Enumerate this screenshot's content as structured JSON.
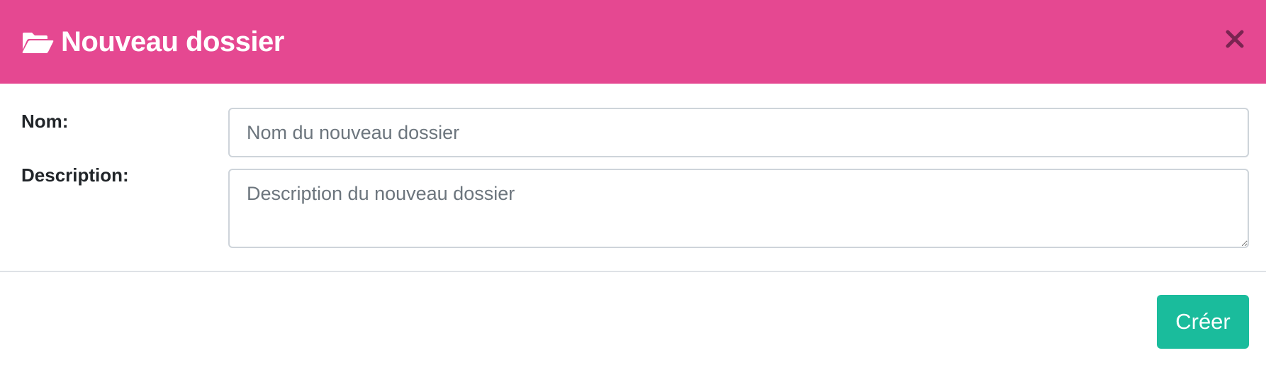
{
  "colors": {
    "header_bg": "#e54891",
    "primary_button_bg": "#1abc9c",
    "close_icon": "#7a2451"
  },
  "header": {
    "icon": "folder-open-icon",
    "title": "Nouveau dossier",
    "close_icon": "close-icon"
  },
  "form": {
    "name": {
      "label": "Nom:",
      "value": "",
      "placeholder": "Nom du nouveau dossier"
    },
    "description": {
      "label": "Description:",
      "value": "",
      "placeholder": "Description du nouveau dossier"
    }
  },
  "footer": {
    "create_label": "Créer"
  }
}
